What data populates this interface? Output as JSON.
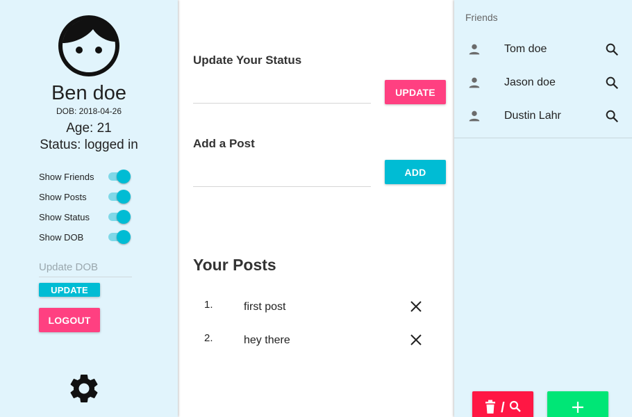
{
  "profile": {
    "name": "Ben doe",
    "dob": "DOB: 2018-04-26",
    "age": "Age: 21",
    "status": "Status: logged in"
  },
  "toggles": [
    {
      "label": "Show Friends",
      "on": true
    },
    {
      "label": "Show Posts",
      "on": true
    },
    {
      "label": "Show Status",
      "on": true
    },
    {
      "label": "Show DOB",
      "on": true
    }
  ],
  "dob_update": {
    "placeholder": "Update DOB",
    "button_label": "UPDATE"
  },
  "logout_label": "LOGOUT",
  "settings_icon": "gear-icon",
  "status_section": {
    "title": "Update Your Status",
    "button_label": "UPDATE"
  },
  "post_section": {
    "title": "Add a Post",
    "button_label": "ADD"
  },
  "posts": {
    "title": "Your Posts",
    "items": [
      {
        "number": "1.",
        "text": "first post"
      },
      {
        "number": "2.",
        "text": "hey there"
      }
    ]
  },
  "friends": {
    "header": "Friends",
    "items": [
      {
        "name": "Tom doe"
      },
      {
        "name": "Jason doe"
      },
      {
        "name": "Dustin Lahr"
      }
    ],
    "delete_search_separator": "/",
    "add_icon": "plus-icon"
  },
  "colors": {
    "sidebar_bg": "#e1f4fc",
    "accent_pink": "#ff4081",
    "accent_cyan": "#00bcd4",
    "delete_red": "#ff1744",
    "add_green": "#00e676"
  }
}
